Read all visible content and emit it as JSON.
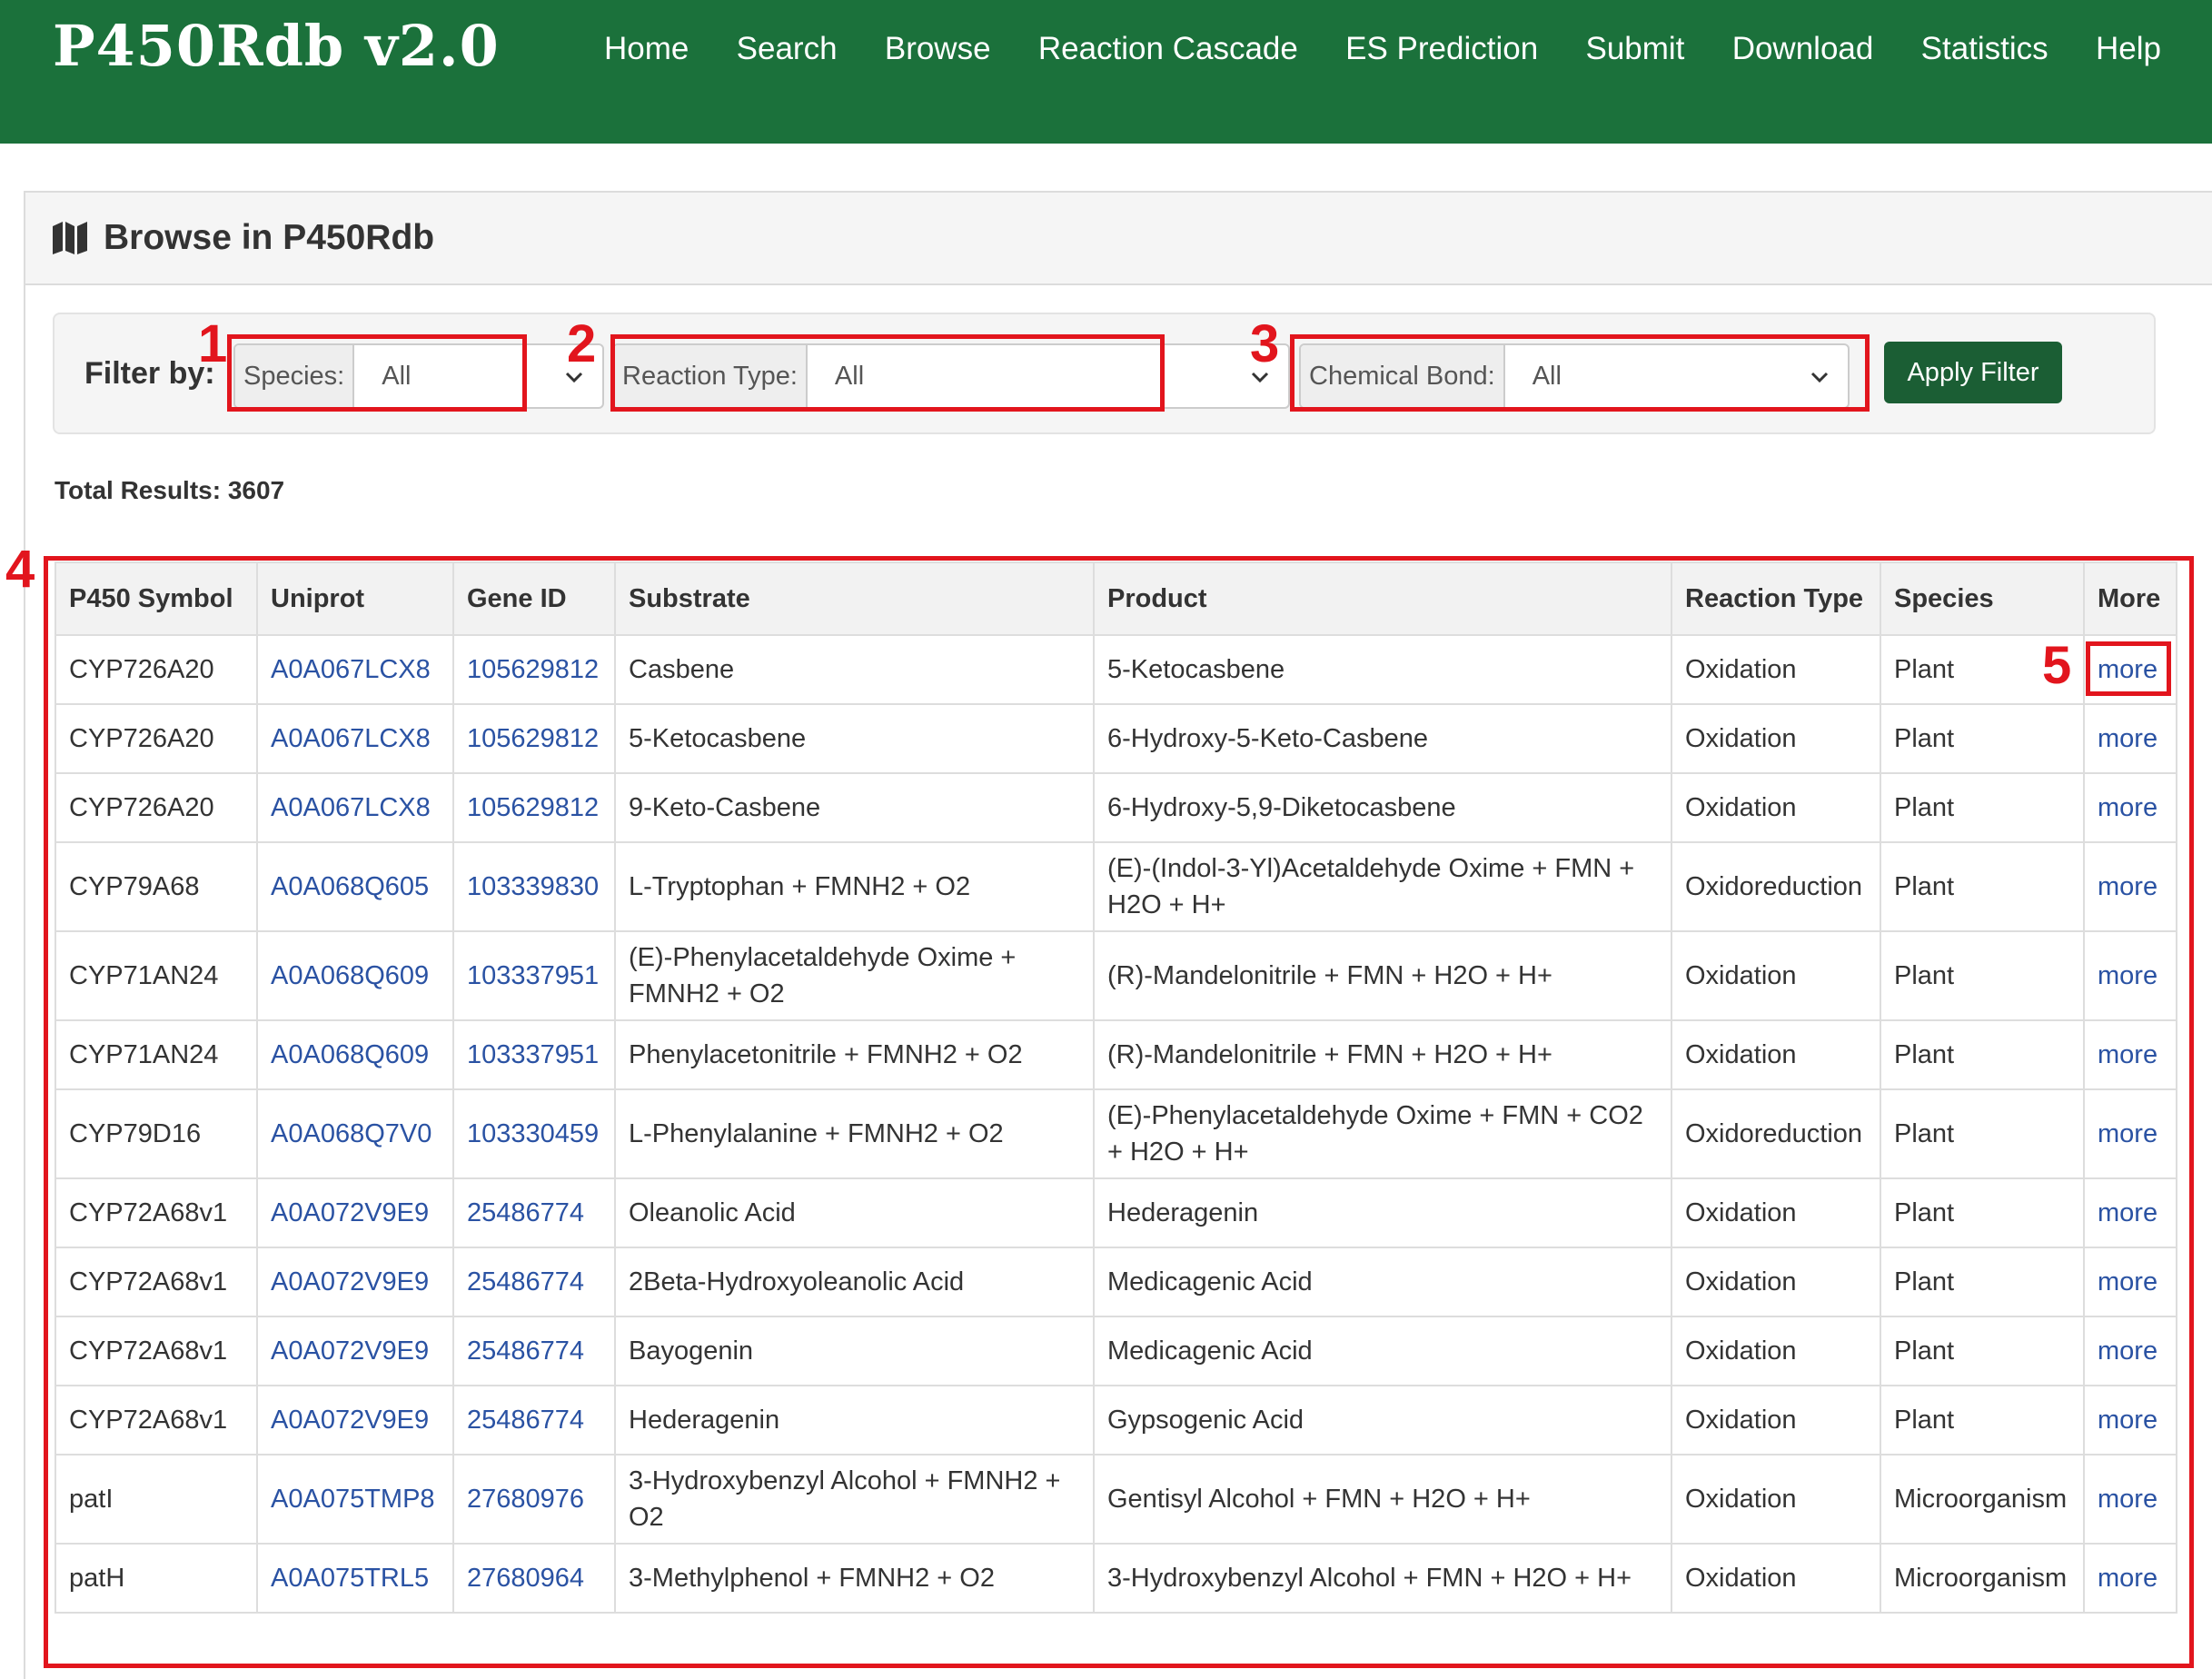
{
  "header": {
    "brand": "P450Rdb v2.0",
    "nav": [
      "Home",
      "Search",
      "Browse",
      "Reaction Cascade",
      "ES Prediction",
      "Submit",
      "Download",
      "Statistics",
      "Help"
    ]
  },
  "panel": {
    "title": "Browse in P450Rdb",
    "icon": "map-icon"
  },
  "filter": {
    "label": "Filter by:",
    "species": {
      "label": "Species:",
      "value": "All"
    },
    "reaction_type": {
      "label": "Reaction Type:",
      "value": "All"
    },
    "chemical_bond": {
      "label": "Chemical Bond:",
      "value": "All"
    },
    "apply_label": "Apply Filter"
  },
  "total": "Total Results: 3607",
  "table": {
    "columns": [
      "P450 Symbol",
      "Uniprot",
      "Gene ID",
      "Substrate",
      "Product",
      "Reaction Type",
      "Species",
      "More"
    ],
    "rows": [
      {
        "symbol": "CYP726A20",
        "uniprot": "A0A067LCX8",
        "gene": "105629812",
        "substrate": "Casbene",
        "product": "5-Ketocasbene",
        "rtype": "Oxidation",
        "species": "Plant",
        "more": "more"
      },
      {
        "symbol": "CYP726A20",
        "uniprot": "A0A067LCX8",
        "gene": "105629812",
        "substrate": "5-Ketocasbene",
        "product": "6-Hydroxy-5-Keto-Casbene",
        "rtype": "Oxidation",
        "species": "Plant",
        "more": "more"
      },
      {
        "symbol": "CYP726A20",
        "uniprot": "A0A067LCX8",
        "gene": "105629812",
        "substrate": "9-Keto-Casbene",
        "product": "6-Hydroxy-5,9-Diketocasbene",
        "rtype": "Oxidation",
        "species": "Plant",
        "more": "more"
      },
      {
        "symbol": "CYP79A68",
        "uniprot": "A0A068Q605",
        "gene": "103339830",
        "substrate": "L-Tryptophan + FMNH2 + O2",
        "product": "(E)-(Indol-3-Yl)Acetaldehyde Oxime + FMN + H2O + H+",
        "rtype": "Oxidoreduction",
        "species": "Plant",
        "more": "more"
      },
      {
        "symbol": "CYP71AN24",
        "uniprot": "A0A068Q609",
        "gene": "103337951",
        "substrate": "(E)-Phenylacetaldehyde Oxime + FMNH2 + O2",
        "product": "(R)-Mandelonitrile + FMN + H2O + H+",
        "rtype": "Oxidation",
        "species": "Plant",
        "more": "more"
      },
      {
        "symbol": "CYP71AN24",
        "uniprot": "A0A068Q609",
        "gene": "103337951",
        "substrate": "Phenylacetonitrile + FMNH2 + O2",
        "product": "(R)-Mandelonitrile + FMN + H2O + H+",
        "rtype": "Oxidation",
        "species": "Plant",
        "more": "more"
      },
      {
        "symbol": "CYP79D16",
        "uniprot": "A0A068Q7V0",
        "gene": "103330459",
        "substrate": "L-Phenylalanine + FMNH2 + O2",
        "product": "(E)-Phenylacetaldehyde Oxime + FMN + CO2 + H2O + H+",
        "rtype": "Oxidoreduction",
        "species": "Plant",
        "more": "more"
      },
      {
        "symbol": "CYP72A68v1",
        "uniprot": "A0A072V9E9",
        "gene": "25486774",
        "substrate": "Oleanolic Acid",
        "product": "Hederagenin",
        "rtype": "Oxidation",
        "species": "Plant",
        "more": "more"
      },
      {
        "symbol": "CYP72A68v1",
        "uniprot": "A0A072V9E9",
        "gene": "25486774",
        "substrate": "2Beta-Hydroxyoleanolic Acid",
        "product": "Medicagenic Acid",
        "rtype": "Oxidation",
        "species": "Plant",
        "more": "more"
      },
      {
        "symbol": "CYP72A68v1",
        "uniprot": "A0A072V9E9",
        "gene": "25486774",
        "substrate": "Bayogenin",
        "product": "Medicagenic Acid",
        "rtype": "Oxidation",
        "species": "Plant",
        "more": "more"
      },
      {
        "symbol": "CYP72A68v1",
        "uniprot": "A0A072V9E9",
        "gene": "25486774",
        "substrate": "Hederagenin",
        "product": "Gypsogenic Acid",
        "rtype": "Oxidation",
        "species": "Plant",
        "more": "more"
      },
      {
        "symbol": "patI",
        "uniprot": "A0A075TMP8",
        "gene": "27680976",
        "substrate": "3-Hydroxybenzyl Alcohol + FMNH2 + O2",
        "product": "Gentisyl Alcohol + FMN + H2O + H+",
        "rtype": "Oxidation",
        "species": "Microorganism",
        "more": "more"
      },
      {
        "symbol": "patH",
        "uniprot": "A0A075TRL5",
        "gene": "27680964",
        "substrate": "3-Methylphenol + FMNH2 + O2",
        "product": "3-Hydroxybenzyl Alcohol + FMN + H2O + H+",
        "rtype": "Oxidation",
        "species": "Microorganism",
        "more": "more"
      }
    ]
  },
  "annotations": [
    "1",
    "2",
    "3",
    "4",
    "5"
  ],
  "colors": {
    "header_green": "#1b713b",
    "button_green": "#1b5e34",
    "link_blue": "#2a52a3",
    "annotation_red": "#e2151d"
  }
}
